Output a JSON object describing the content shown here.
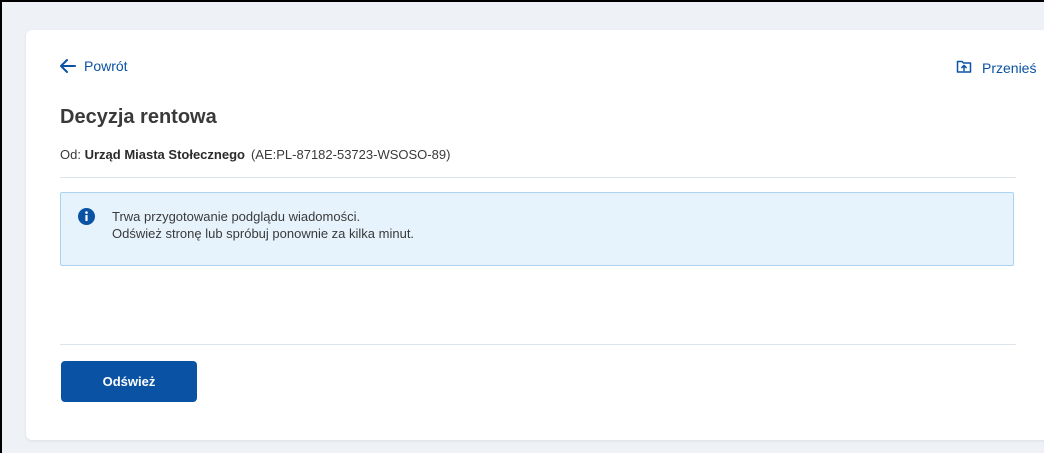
{
  "nav": {
    "back_label": "Powrót",
    "move_label": "Przenieś"
  },
  "message": {
    "title": "Decyzja rentowa",
    "from_prefix": "Od:",
    "sender_name": "Urząd Miasta Stołecznego",
    "sender_address": "(AE:PL-87182-53723-WSOSO-89)"
  },
  "notice": {
    "icon": "info-icon",
    "line1": "Trwa przygotowanie podglądu wiadomości.",
    "line2": "Odśwież stronę lub spróbuj ponownie za kilka minut."
  },
  "actions": {
    "refresh_label": "Odśwież"
  },
  "colors": {
    "primary": "#0a52a3",
    "info_bg": "#e6f3fd",
    "info_border": "#a9d3f3",
    "page_bg": "#eef2f6"
  }
}
